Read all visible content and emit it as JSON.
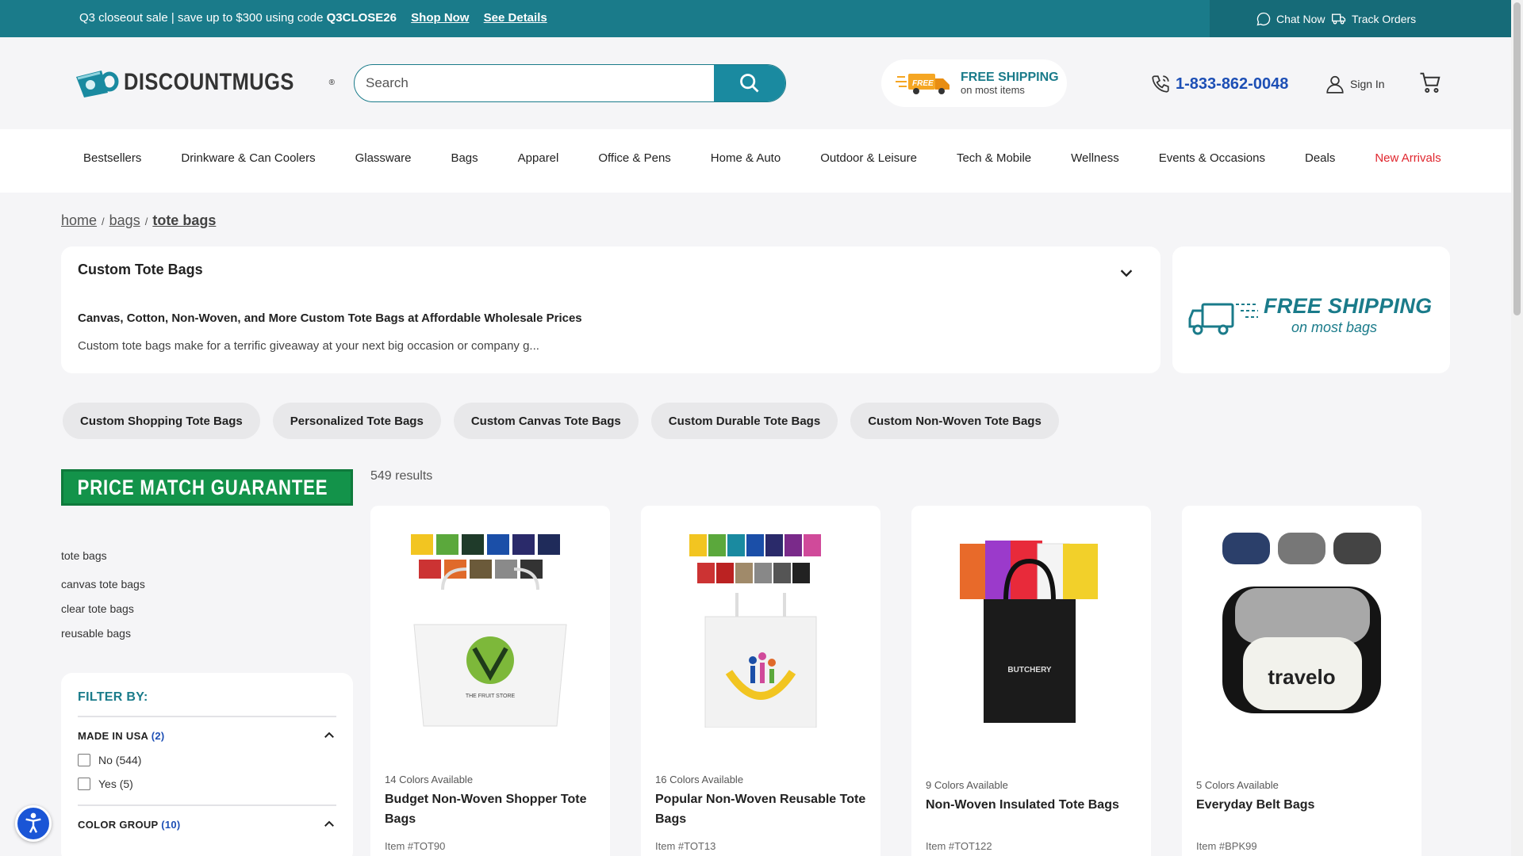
{
  "topbar": {
    "promo_text": "Q3 closeout sale | save up to $300 using code ",
    "promo_code": "Q3CLOSE26",
    "shop_now": "Shop Now",
    "see_details": "See Details",
    "chat_now": "Chat Now",
    "track_orders": "Track Orders"
  },
  "header": {
    "logo_text": "DISCOUNTMUGS",
    "logo_mark": "®",
    "search_placeholder": "Search",
    "free_shipping_title": "FREE SHIPPING",
    "free_shipping_sub": "on most items",
    "free_badge": "FREE",
    "phone": "1-833-862-0048",
    "sign_in": "Sign In"
  },
  "nav": {
    "items": [
      "Bestsellers",
      "Drinkware & Can Coolers",
      "Glassware",
      "Bags",
      "Apparel",
      "Office & Pens",
      "Home & Auto",
      "Outdoor & Leisure",
      "Tech & Mobile",
      "Wellness",
      "Events & Occasions",
      "Deals",
      "New Arrivals"
    ]
  },
  "breadcrumb": {
    "home": "home",
    "bags": "bags",
    "current": "tote bags",
    "sep": "/"
  },
  "description": {
    "title": "Custom Tote Bags",
    "subtitle": "Canvas, Cotton, Non-Woven, and More Custom Tote Bags at Affordable Wholesale Prices",
    "text": "Custom tote bags make for a terrific giveaway at your next big occasion or company g..."
  },
  "shipping_banner": {
    "line1": "FREE SHIPPING",
    "line2": "on most bags"
  },
  "chips": [
    "Custom Shopping Tote Bags",
    "Personalized Tote Bags",
    "Custom Canvas Tote Bags",
    "Custom Durable Tote Bags",
    "Custom Non-Woven Tote Bags"
  ],
  "price_match": "PRICE MATCH GUARANTEE",
  "results": "549 results",
  "sidebar": {
    "category": "tote bags",
    "links": [
      "canvas tote bags",
      "clear tote bags",
      "reusable bags"
    ]
  },
  "filter": {
    "title": "FILTER BY:",
    "made_in_usa": {
      "label": "MADE IN USA",
      "count": "(2)",
      "options": [
        "No (544)",
        "Yes (5)"
      ]
    },
    "color_group": {
      "label": "COLOR GROUP",
      "count": "(10)"
    }
  },
  "products": [
    {
      "colors": "14 Colors Available",
      "name": "Budget Non-Woven Shopper Tote Bags",
      "item": "Item #TOT90",
      "print": "THE FRUIT STORE"
    },
    {
      "colors": "16 Colors Available",
      "name": "Popular Non-Woven Reusable Tote Bags",
      "item": "Item #TOT13"
    },
    {
      "colors": "9 Colors Available",
      "name": "Non-Woven Insulated Tote Bags",
      "item": "Item #TOT122",
      "print": "BUTCHERY"
    },
    {
      "colors": "5 Colors Available",
      "name": "Everyday Belt Bags",
      "item": "Item #BPK99",
      "print": "travelo"
    }
  ],
  "colors": {
    "teal": "#1a7b8a",
    "green": "#13934a",
    "red": "#e0262e",
    "blue": "#1d4fb5"
  }
}
